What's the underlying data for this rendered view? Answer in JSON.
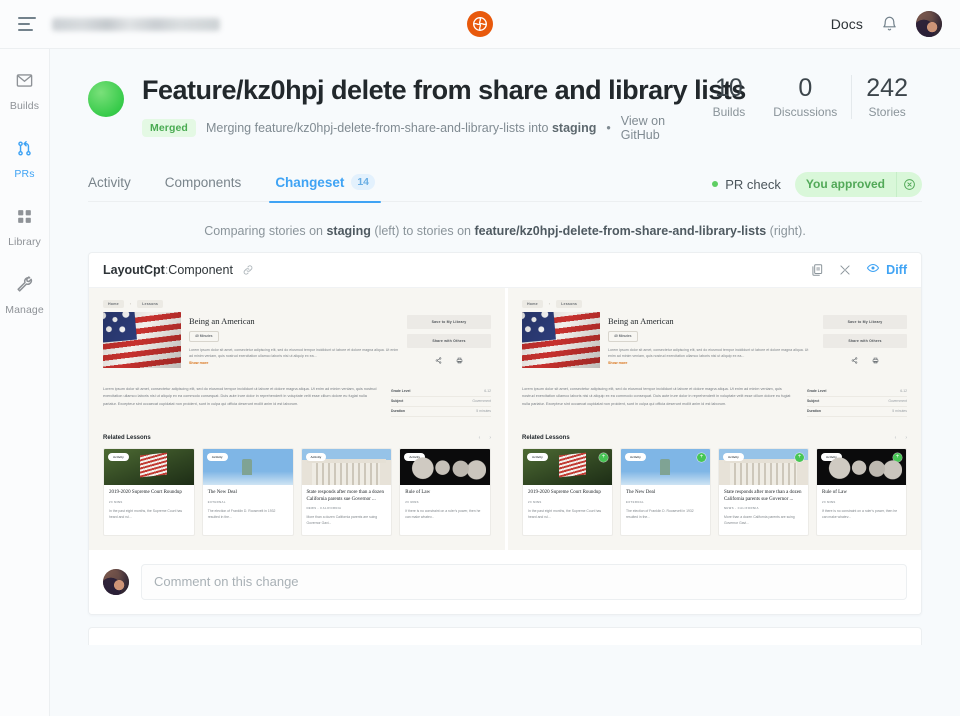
{
  "topbar": {
    "menu_icon": "hamburger-icon",
    "project_name_blurred": "",
    "logo_icon": "chromatic-logo-icon",
    "docs_label": "Docs",
    "notifications_icon": "bell-icon",
    "avatar_icon": "user-avatar"
  },
  "sidebar": {
    "items": [
      {
        "label": "Builds",
        "icon": "builds-icon",
        "active": false
      },
      {
        "label": "PRs",
        "icon": "pull-request-icon",
        "active": true
      },
      {
        "label": "Library",
        "icon": "library-grid-icon",
        "active": false
      },
      {
        "label": "Manage",
        "icon": "wrench-icon",
        "active": false
      }
    ]
  },
  "pr": {
    "status_color": "#37cb4a",
    "title": "Feature/kz0hpj delete from share and library lists",
    "badge": "Merged",
    "subtitle_prefix": "Merging ",
    "branch": "feature/kz0hpj-delete-from-share-and-library-lists",
    "subtitle_mid": " into ",
    "target_branch": "staging",
    "bullet": "•",
    "github_link": "View on GitHub",
    "stats": [
      {
        "value": "10",
        "label": "Builds"
      },
      {
        "value": "0",
        "label": "Discussions"
      },
      {
        "value": "242",
        "label": "Stories"
      }
    ]
  },
  "tabs": {
    "items": [
      {
        "label": "Activity",
        "badge": "",
        "active": false
      },
      {
        "label": "Components",
        "badge": "",
        "active": false
      },
      {
        "label": "Changeset",
        "badge": "14",
        "active": true
      }
    ],
    "pr_check_label": "PR check",
    "approved_label": "You approved",
    "dismiss_icon": "circle-x-icon",
    "accent_color": "#3fa3f4",
    "approved_color": "#52a958"
  },
  "compare": {
    "prefix": "Comparing stories on ",
    "left_branch": "staging",
    "left_side": " (left) to stories on ",
    "right_branch": "feature/kz0hpj-delete-from-share-and-library-lists",
    "right_side": " (right)."
  },
  "diff_card": {
    "component_name": "LayoutCpt",
    "component_sep": ":",
    "component_kind": "Component",
    "link_icon": "link-icon",
    "copy_icon": "copy-snapshot-icon",
    "hide_icon": "crossed-out-icon",
    "eye_icon": "eye-icon",
    "diff_label": "Diff"
  },
  "snapshot": {
    "breadcrumbs": [
      "Home",
      "Lessons"
    ],
    "breadcrumb_sep": "›",
    "lesson_title": "Being an American",
    "duration_badge": "40 Minutes",
    "hero_paragraph": "Lorem ipsum dolor sit amet, consectetur adipiscing elit, sed do eiusmod tempor incididunt ut labore et dolore magna aliqua. Ut enim ad minim veniam, quis nostrud exercitation ullamco laboris nisi ut aliquip ex ea...",
    "show_more": "Show more",
    "save_button": "Save to My Library",
    "share_button": "Share with Others",
    "share_icon": "share-icon",
    "print_icon": "print-icon",
    "body_paragraph": "Lorem ipsum dolor sit amet, consectetur adipiscing elit, sed do eiusmod tempor incididunt ut labore et dolore magna aliqua. Ut enim ad minim veniam, quis nostrud exercitation ullamco laboris nisi ut aliquip ex ea commodo consequat. Duis aute irure dolor in reprehenderit in voluptate velit esse cillum dolore eu fugiat nulla pariatur. Excepteur sint occaecat cupidatat non proident, sunt in culpa qui officia deserunt mollit anim id est laborum.",
    "meta": [
      {
        "key": "Grade Level",
        "value": "6-12"
      },
      {
        "key": "Subject",
        "value": "Government"
      },
      {
        "key": "Duration",
        "value": "5 minutes"
      }
    ],
    "related_title": "Related Lessons",
    "prev_arrow": "‹",
    "next_arrow": "›",
    "related_cards": [
      {
        "badge": "Activity",
        "title": "2019-2020 Supreme Court Roundup",
        "kicker": "20 MINS",
        "desc": "In the past eight months, the Supreme Court has heard and rul...",
        "photo": "ph-flagpole"
      },
      {
        "badge": "Activity",
        "title": "The New Deal",
        "kicker": "EXTERNAL",
        "desc": "The election of Franklin D. Roosevelt in 1932 resulted in the...",
        "photo": "ph-liberty"
      },
      {
        "badge": "Activity",
        "title": "State responds after more than a dozen California parents sue Governor ...",
        "kicker": "NEWS · CALIFORNIA",
        "desc": "More than a dozen California parents are suing Governor Gavi...",
        "photo": "ph-court"
      },
      {
        "badge": "Activity",
        "title": "Rule of Law",
        "kicker": "20 MINS",
        "desc": "If there is no constraint on a ruler's power, then he can make whatev...",
        "photo": "ph-rushmore"
      }
    ],
    "added_badge_icon": "plus-circle-icon"
  },
  "comment": {
    "placeholder": "Comment on this change",
    "avatar_icon": "user-avatar"
  }
}
